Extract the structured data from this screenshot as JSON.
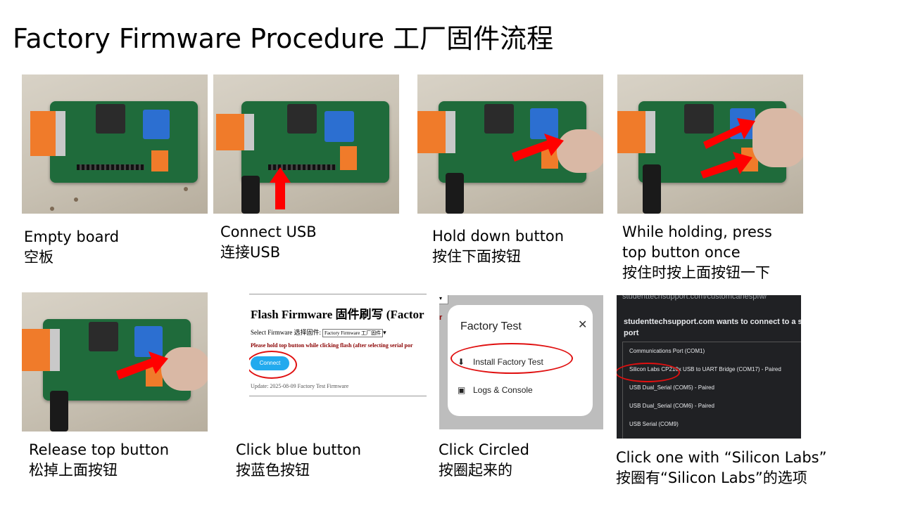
{
  "title": "Factory Firmware Procedure 工厂固件流程",
  "steps": [
    {
      "caption_en": "Empty board",
      "caption_cn": "空板"
    },
    {
      "caption_en": "Connect USB",
      "caption_cn": "连接USB"
    },
    {
      "caption_en": "Hold down button",
      "caption_cn": "按住下面按钮"
    },
    {
      "caption_en": "While holding, press",
      "caption_en2": "top button once",
      "caption_cn": "按住时按上面按钮一下"
    },
    {
      "caption_en": "Release top button",
      "caption_cn": "松掉上面按钮"
    },
    {
      "caption_en": "Click blue button",
      "caption_cn": "按蓝色按钮"
    },
    {
      "caption_en": "Click Circled",
      "caption_cn": "按圈起来的"
    },
    {
      "caption_en": "Click one with “Silicon Labs”",
      "caption_cn": "按圈有“Silicon Labs”的选项"
    }
  ],
  "flash_page": {
    "heading": "Flash Firmware 固件刷写 (Factor",
    "select_label": "Select Firmware 选择固件:",
    "select_value": "Factory Firmware 工厂固件",
    "warning": "Please hold top button while clicking flash (after selecting serial por",
    "connect_label": "Connect",
    "update_text": "Update: 2025-08-09 Factory Test Firmware",
    "button_color": "#22aaee"
  },
  "install_dialog": {
    "partial_text": "r",
    "title": "Factory Test",
    "close_icon": "close-icon",
    "items": [
      {
        "label": "Install Factory Test",
        "icon": "download-icon"
      },
      {
        "label": "Logs & Console",
        "icon": "terminal-icon"
      }
    ]
  },
  "serial_picker": {
    "url": "studenttechsupport.com/customcanespfw/",
    "heading_line1": "studenttechsupport.com wants to connect to a seria",
    "heading_line2": "port",
    "ports": [
      "Communications Port (COM1)",
      "Silicon Labs CP210x USB to UART Bridge (COM17) - Paired",
      "USB Dual_Serial (COM5) - Paired",
      "USB Dual_Serial (COM6) - Paired",
      "USB Serial (COM9)"
    ]
  },
  "colors": {
    "highlight_ring": "#e01010",
    "arrow": "#ff0000"
  }
}
